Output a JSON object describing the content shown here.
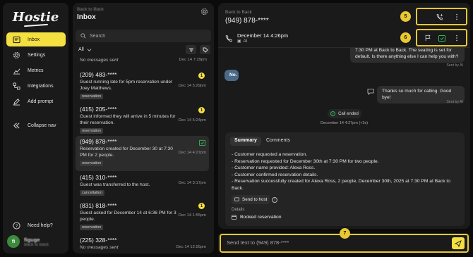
{
  "app": {
    "logo": "Hostie",
    "accent": "#f5e042",
    "highlight": "#e9c832"
  },
  "sidebar": {
    "items": [
      {
        "label": "Inbox",
        "icon": "inbox-icon",
        "active": true
      },
      {
        "label": "Settings",
        "icon": "gear-icon"
      },
      {
        "label": "Metrics",
        "icon": "bar-chart-icon"
      },
      {
        "label": "Integrations",
        "icon": "integrations-icon"
      },
      {
        "label": "Add prompt",
        "icon": "pencil-icon"
      },
      {
        "label": "Collapse nav",
        "icon": "double-chevron-left-icon"
      }
    ],
    "help": "Need help?",
    "user": {
      "initials": "fi",
      "name": "figuge",
      "org": "Back to Back"
    }
  },
  "inbox": {
    "org": "Back to Back",
    "title": "Inbox",
    "search_placeholder": "Search",
    "filter": "All",
    "top_partial": {
      "msg": "No messages sent",
      "date": "Dec 14 7:29pm"
    },
    "conversations": [
      {
        "phone": "(209) 483-****",
        "msg": "Guest running late for 5pm reservation under Joey Matthews.",
        "tag": "reservation",
        "date": "Dec 14 5:29pm",
        "badge": "1"
      },
      {
        "phone": "(415) 205-****",
        "msg": "Guest informed they will arrive in 5 minutes for their reservation.",
        "tag": "reservation",
        "date": "Dec 14 5:24pm",
        "badge": "1"
      },
      {
        "phone": "(949) 878-****",
        "msg": "Reservation created for December 30 at 7:30 PM for 2 people.",
        "tag": "reservation",
        "date": "Dec 14 4:27pm"
      },
      {
        "phone": "(415) 310-****",
        "msg": "Guest was transferred to the host.",
        "tag": "cancellation",
        "date": "Dec 14 3:17pm"
      },
      {
        "phone": "(831) 818-****",
        "msg": "Guest asked for December 14 at 6:36 PM for 3 people.",
        "tag": "reservation",
        "date": "Dec 14 1:55pm",
        "badge": "1"
      },
      {
        "phone": "(225) 328-****",
        "msg": "No messages sent",
        "date": "Dec 14 12:55pm"
      }
    ]
  },
  "conversation": {
    "org": "Back to Back",
    "phone": "(949) 878-****",
    "call_date": "December 14 4:26pm",
    "call_ai": "AI",
    "badge5": "5",
    "badge6": "6",
    "badge7": "7",
    "messages": {
      "ai_partial": "7:30 PM at Back to Back. The seating is set for default. Is there anything else I can help you with?",
      "sent_by_1": "Sent by AI",
      "user_no": "No.",
      "ai_bye": "Thanks so much for calling. Good bye!",
      "sent_by_2": "Sent by AI"
    },
    "call_ended": "Call ended",
    "call_ended_ts": "December 14 4:27pm (+3s)",
    "tabs": [
      "Summary",
      "Comments"
    ],
    "summary": [
      "- Customer requested a reservation.",
      "- Reservation requested for December 30th at 7:30 PM for two people.",
      "- Customer name provided: Alexa Ross.",
      "- Customer confirmed reservation details.",
      "- Reservation successfully created for Alexa Ross, 2 people, December 30th, 2025 at 7:30 PM at Back to Back."
    ],
    "send_to_host": "Send to host",
    "details_label": "Details",
    "booked": "Booked reservation"
  },
  "composer": {
    "placeholder": "Send text to (949) 878-****"
  }
}
